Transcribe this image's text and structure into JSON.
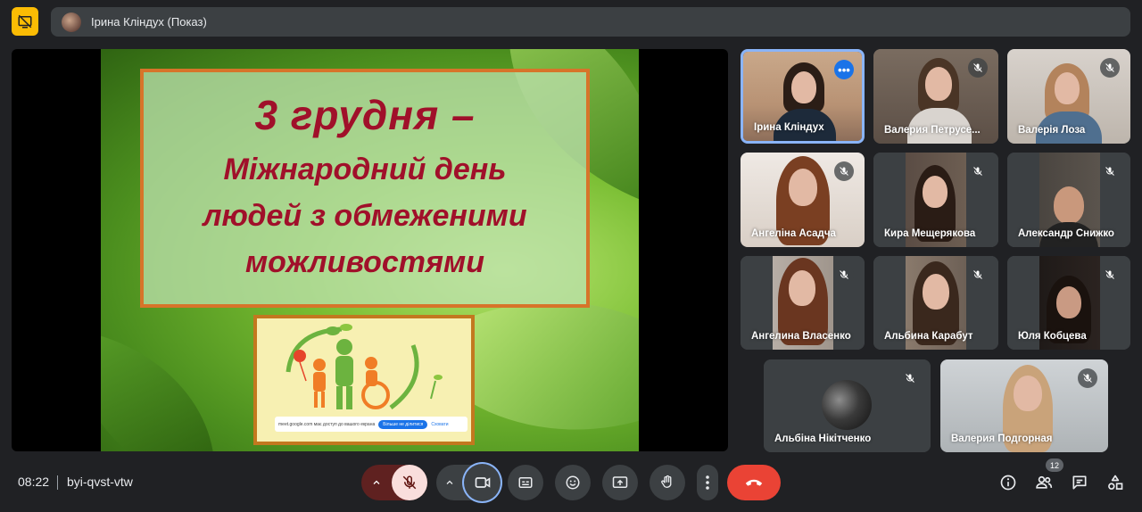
{
  "presenter_bar": {
    "name": "Ірина Кліндух (Показ)"
  },
  "slide": {
    "line1": "3 грудня –",
    "line2": "Міжнародний день",
    "line3": "людей з обмеженими",
    "line4": "можливостями",
    "share_banner": {
      "text": "meet.google.com має доступ до вашого екрана",
      "stop_label": "Більше не ділитися",
      "hide_label": "Сховати"
    }
  },
  "participants": [
    {
      "name": "Ірина Кліндух"
    },
    {
      "name": "Валерия Петрусе..."
    },
    {
      "name": "Валерія Лоза"
    },
    {
      "name": "Ангеліна Асадча"
    },
    {
      "name": "Кира Мещерякова"
    },
    {
      "name": "Александр Снижко"
    },
    {
      "name": "Ангелина Власенко"
    },
    {
      "name": "Альбина Карабут"
    },
    {
      "name": "Юля Кобцева"
    },
    {
      "name": "Альбіна Нікітченко"
    },
    {
      "name": "Валерия Подгорная"
    }
  ],
  "footer": {
    "time": "08:22",
    "meeting_code": "byi-qvst-vtw",
    "people_count": "12"
  },
  "icons": {
    "present": "present-off-icon",
    "mic": "mic-off-icon",
    "camera": "camera-icon",
    "captions": "captions-icon",
    "emoji": "emoji-icon",
    "present_now": "present-now-icon",
    "hand": "raise-hand-icon",
    "more": "more-vert-icon",
    "leave": "call-end-icon",
    "info": "info-icon",
    "people": "people-icon",
    "chat": "chat-icon",
    "activities": "activities-icon"
  },
  "colors": {
    "background": "#202124",
    "present_accent": "#fbbc04",
    "leave": "#ea4335",
    "active_border": "#8ab4f8",
    "slide_title": "#a0102a"
  }
}
